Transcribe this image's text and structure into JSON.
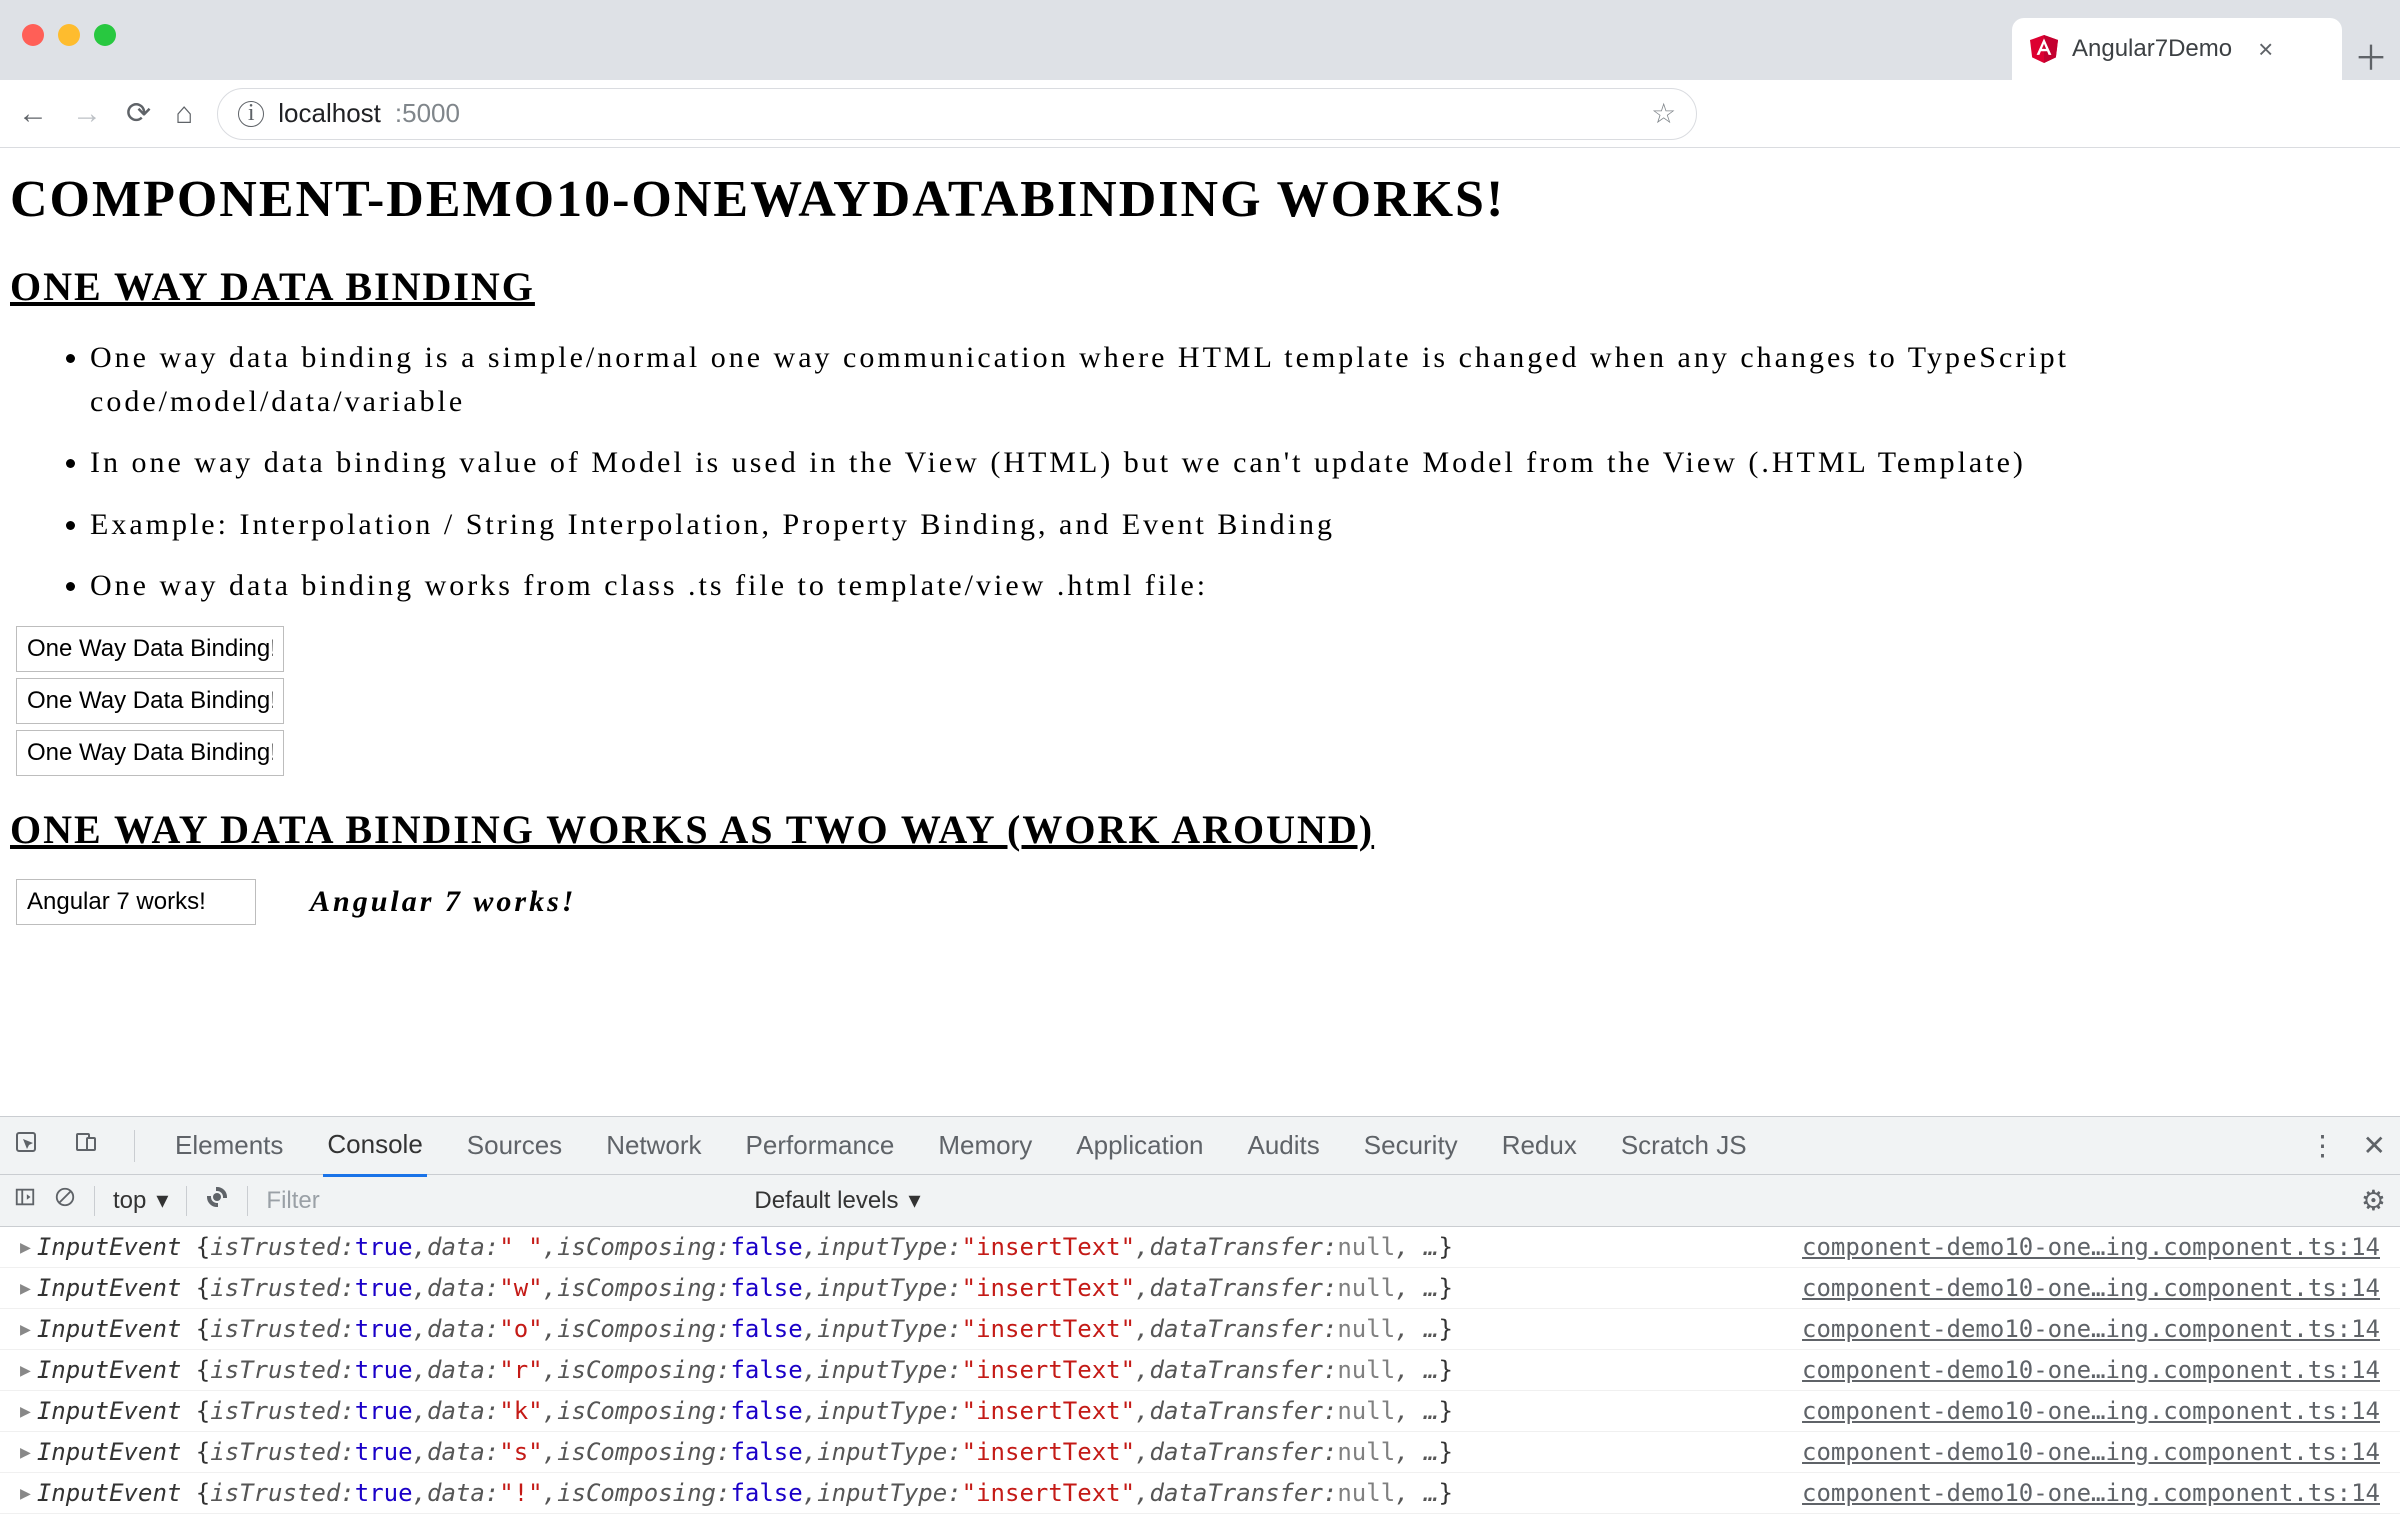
{
  "browser": {
    "tab_title": "Angular7Demo",
    "url_host": "localhost",
    "url_port": ":5000"
  },
  "page": {
    "h1": "COMPONENT-DEMO10-ONEWAYDATABINDING WORKS!",
    "h2a": "ONE WAY DATA BINDING",
    "bullets": [
      "One way data binding is a simple/normal one way communication where HTML template is changed when any changes to TypeScript code/model/data/variable",
      "In one way data binding value of Model is used in the View (HTML) but we can't update Model from the View (.HTML Template)",
      "Example: Interpolation / String Interpolation, Property Binding, and Event Binding",
      "One way data binding works from class .ts file to template/view .html file:"
    ],
    "input_value": "One Way Data Binding!",
    "h2b": "ONE WAY DATA BINDING WORKS AS TWO WAY (WORK AROUND)",
    "twoway_value": "Angular 7 works!",
    "twoway_output": "Angular 7 works!"
  },
  "devtools": {
    "tabs": [
      "Elements",
      "Console",
      "Sources",
      "Network",
      "Performance",
      "Memory",
      "Application",
      "Audits",
      "Security",
      "Redux",
      "Scratch JS"
    ],
    "active_tab": "Console",
    "context": "top",
    "filter_placeholder": "Filter",
    "levels": "Default levels",
    "source_link": "component-demo10-one…ing.component.ts:14",
    "log_prefix": "InputEvent",
    "logs": [
      {
        "data": "\" \""
      },
      {
        "data": "\"w\""
      },
      {
        "data": "\"o\""
      },
      {
        "data": "\"r\""
      },
      {
        "data": "\"k\""
      },
      {
        "data": "\"s\""
      },
      {
        "data": "\"!\""
      }
    ],
    "log_template": {
      "isTrusted": "true",
      "isComposing": "false",
      "inputType": "\"insertText\"",
      "dataTransfer": "null"
    }
  }
}
